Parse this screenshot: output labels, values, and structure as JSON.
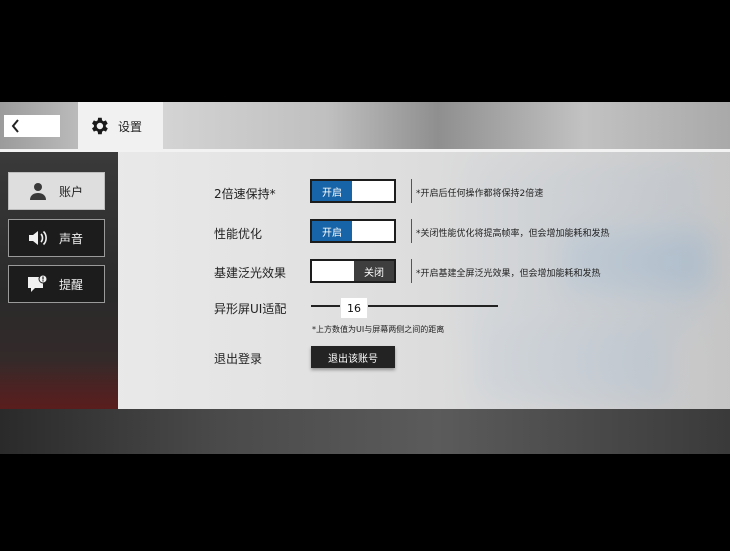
{
  "header": {
    "title": "设置",
    "back_icon": "chevron-left-icon",
    "settings_icon": "gear-icon"
  },
  "sidebar": {
    "items": [
      {
        "label": "账户",
        "icon": "user-icon",
        "active": true
      },
      {
        "label": "声音",
        "icon": "speaker-icon",
        "active": false
      },
      {
        "label": "提醒",
        "icon": "notification-icon",
        "active": false
      }
    ]
  },
  "settings": {
    "speed_keep": {
      "label": "2倍速保持*",
      "state": "开启",
      "desc": "*开启后任何操作都将保持2倍速"
    },
    "perf_opt": {
      "label": "性能优化",
      "state": "开启",
      "desc": "*关闭性能优化将提高帧率，但会增加能耗和发热"
    },
    "glow": {
      "label": "基建泛光效果",
      "state": "关闭",
      "desc": "*开启基建全屏泛光效果，但会增加能耗和发热"
    },
    "notch": {
      "label": "异形屏UI适配",
      "value": "16",
      "note": "*上方数值为UI与屏幕两侧之间的距离"
    },
    "logout": {
      "label": "退出登录",
      "button": "退出该账号"
    }
  },
  "colors": {
    "accent_on": "#1764a8",
    "off_part": "#3e3e3e",
    "button_dark": "#232323"
  }
}
